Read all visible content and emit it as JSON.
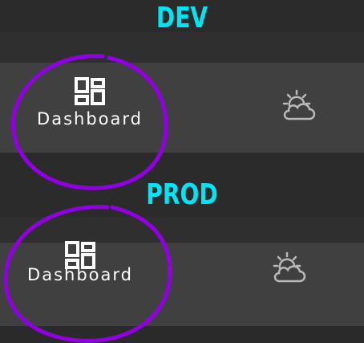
{
  "sections": [
    {
      "title": "DEV",
      "tile_label": "Dashboard",
      "tile_icon": "dashboard-icon",
      "side_icon": "weather-icon"
    },
    {
      "title": "PROD",
      "tile_label": "Dashboard",
      "tile_icon": "dashboard-icon",
      "side_icon": "weather-icon"
    }
  ],
  "colors": {
    "section_title": "#00e5f5",
    "annotation": "#9000e0",
    "row_background": "#404040",
    "page_background": "#262626",
    "icon_grey": "#b8b8b8"
  }
}
